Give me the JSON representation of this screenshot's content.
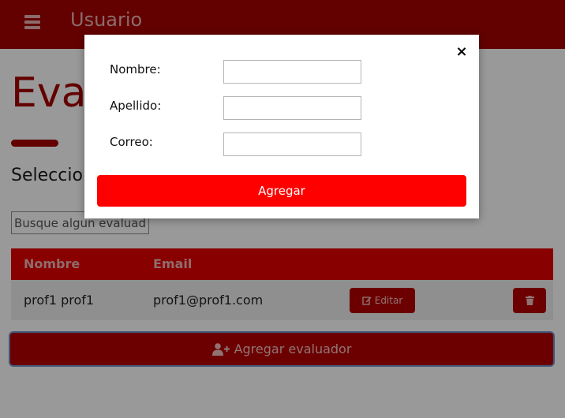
{
  "header": {
    "menu_icon": "hamburger-icon",
    "title": "Usuario"
  },
  "page": {
    "title": "Eval",
    "section_heading": "Seleccio",
    "search": {
      "value": "",
      "placeholder": "Busque algun evaluador"
    },
    "table": {
      "columns": [
        "Nombre",
        "Email"
      ],
      "rows": [
        {
          "nombre": "prof1 prof1",
          "email": "prof1@prof1.com",
          "edit_label": "Editar",
          "edit_icon": "edit-icon",
          "delete_icon": "trash-icon"
        }
      ]
    },
    "add_button": {
      "label": "Agregar evaluador",
      "icon": "user-plus-icon"
    }
  },
  "modal": {
    "close_icon": "close-icon",
    "close_glyph": "×",
    "fields": [
      {
        "label": "Nombre:",
        "value": ""
      },
      {
        "label": "Apellido:",
        "value": ""
      },
      {
        "label": "Correo:",
        "value": ""
      }
    ],
    "submit_label": "Agregar"
  },
  "colors": {
    "header_bg": "#a50000",
    "primary_red": "#ff0000",
    "table_header": "#e30000",
    "button_red": "#b40000"
  }
}
